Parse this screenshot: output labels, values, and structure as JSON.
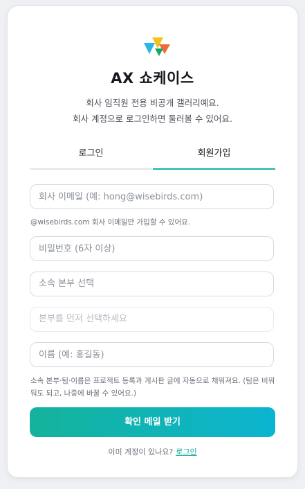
{
  "header": {
    "logo_icon": "ax-logo-icon",
    "title": "AX 쇼케이스",
    "subtitle_line1": "회사 임직원 전용 비공개 갤러리예요.",
    "subtitle_line2": "회사 계정으로 로그인하면 둘러볼 수 있어요."
  },
  "tabs": [
    {
      "label": "로그인",
      "active": false
    },
    {
      "label": "회원가입",
      "active": true
    }
  ],
  "form": {
    "email_placeholder": "회사 이메일 (예: hong@wisebirds.com)",
    "email_hint": "@wisebirds.com 회사 이메일만 가입할 수 있어요.",
    "password_placeholder": "비밀번호 (6자 이상)",
    "division_placeholder": "소속 본부 선택",
    "team_placeholder": "본부를 먼저 선택하세요",
    "name_placeholder": "이름 (예: 홍길동)",
    "info_hint": "소속 본부·팀·이름은 프로젝트 등록과 게시판 글에 자동으로 채워져요. (팀은 비워둬도 되고, 나중에 바꿀 수 있어요.)",
    "submit_label": "확인 메일 받기"
  },
  "footer": {
    "question": "이미 계정이 있나요?",
    "login_link": "로그인"
  },
  "colors": {
    "accent": "#17b0a5",
    "button_gradient_start": "#15b39b",
    "button_gradient_end": "#0bb4d0"
  }
}
